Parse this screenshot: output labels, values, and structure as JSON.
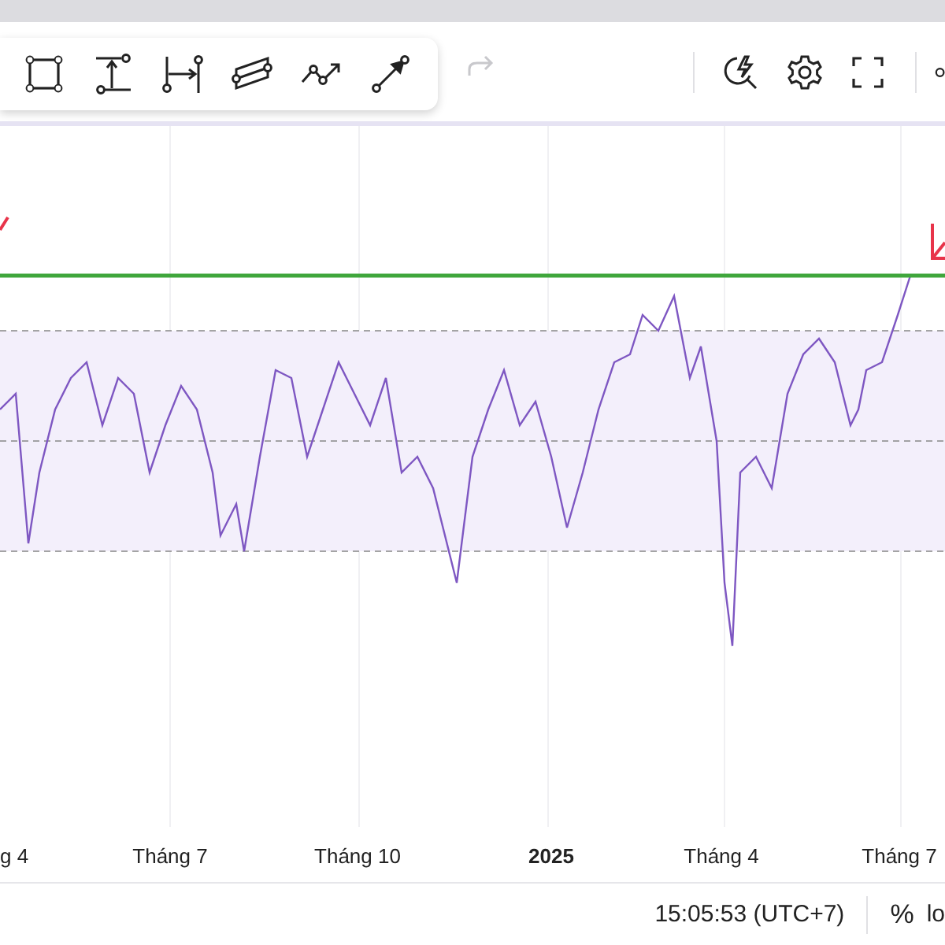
{
  "toolbar": {
    "redo": {
      "disabled": true
    }
  },
  "x_axis": [
    {
      "label": "g 4",
      "kind": "month"
    },
    {
      "label": "Tháng 7",
      "kind": "month"
    },
    {
      "label": "Tháng 10",
      "kind": "month"
    },
    {
      "label": "2025",
      "kind": "year"
    },
    {
      "label": "Tháng 4",
      "kind": "month"
    },
    {
      "label": "Tháng 7",
      "kind": "month"
    }
  ],
  "status_bar": {
    "time": "15:05:53 (UTC+7)",
    "percent": "%",
    "log": "lo"
  }
}
